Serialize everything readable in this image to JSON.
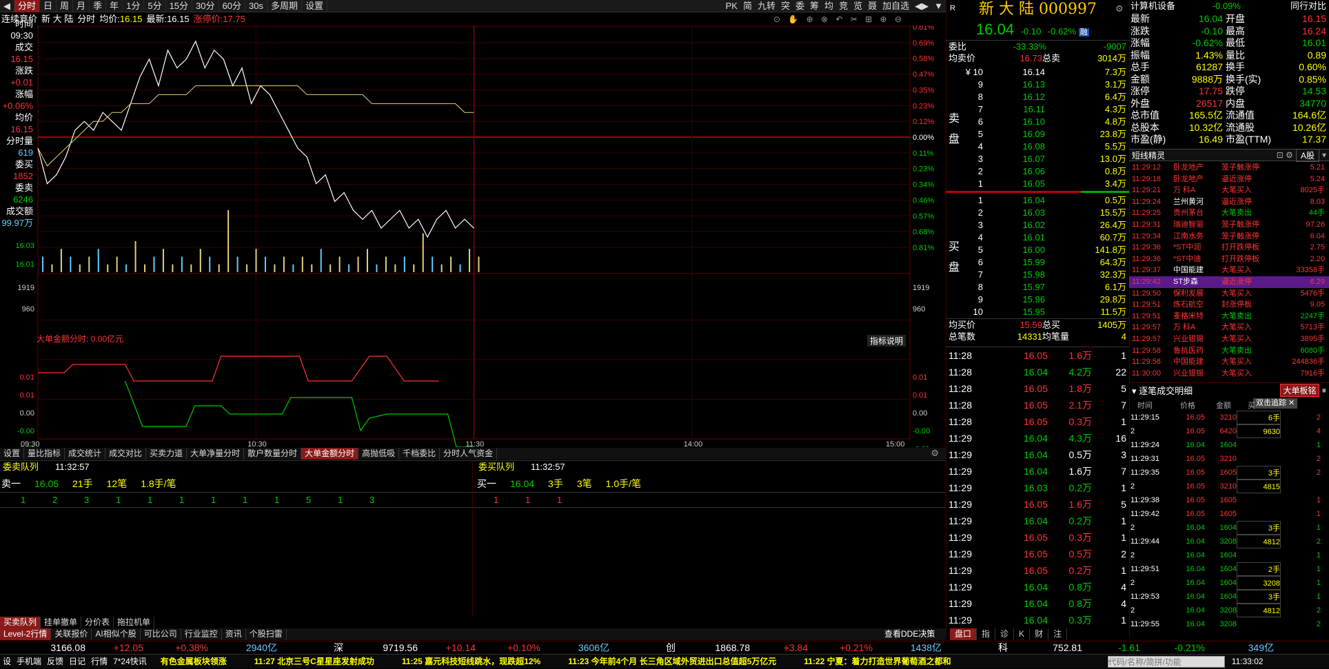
{
  "toolbar": {
    "items": [
      "分时",
      "日",
      "周",
      "月",
      "季",
      "年",
      "1分",
      "5分",
      "15分",
      "30分",
      "60分",
      "30s",
      "多周期",
      "设置"
    ],
    "active": 0,
    "right": [
      "PK",
      "简",
      "九转",
      "突",
      "委",
      "筹",
      "均",
      "竞",
      "览",
      "聂",
      "加自选",
      "◀▶",
      "▼"
    ]
  },
  "info": {
    "mode": "连续竞价",
    "name": "新 大 陆",
    "label_fs": "分时",
    "label_avg": "均价:",
    "avg": "16.15",
    "label_last": "最新:",
    "last": "16.15",
    "label_limit": "涨停价:",
    "limit": "17.75"
  },
  "left": {
    "rows": [
      {
        "l": "时间",
        "v": "09:30",
        "c": "w"
      },
      {
        "l": "成交",
        "v": "16.15",
        "c": "r"
      },
      {
        "l": "涨跌",
        "v": "+0.01",
        "c": "r"
      },
      {
        "l": "涨幅",
        "v": "+0.06%",
        "c": "r"
      },
      {
        "l": "均价",
        "v": "16.15",
        "c": "r"
      },
      {
        "l": "分时量",
        "v": "619",
        "c": "c"
      },
      {
        "l": "委买",
        "v": "1852",
        "c": "r"
      },
      {
        "l": "委卖",
        "v": "6246",
        "c": "g"
      },
      {
        "l": "成交额",
        "v": "99.97万",
        "c": "c"
      }
    ]
  },
  "chart_data": {
    "type": "line",
    "title": "",
    "price_ticks_left": [
      "16.03",
      "16.01"
    ],
    "pct_ticks_right": [
      "0.81%",
      "0.69%",
      "0.58%",
      "0.47%",
      "0.35%",
      "0.23%",
      "0.12%",
      "0.00%",
      "0.11%",
      "0.23%",
      "0.34%",
      "0.46%",
      "0.57%",
      "0.68%",
      "0.81%"
    ],
    "vol_ticks": [
      "1919",
      "960"
    ],
    "x_labels": [
      "09:30",
      "10:30",
      "11:30",
      "14:00",
      "15:00"
    ],
    "price": [
      16.1,
      16.06,
      16.07,
      16.09,
      16.12,
      16.13,
      16.12,
      16.14,
      16.13,
      16.12,
      16.15,
      16.18,
      16.2,
      16.17,
      16.21,
      16.19,
      16.2,
      16.22,
      16.19,
      16.21,
      16.2,
      16.17,
      16.19,
      16.15,
      16.17,
      16.16,
      16.14,
      16.12,
      16.1,
      16.09,
      16.06,
      16.07,
      16.04,
      16.05,
      16.03,
      16.02,
      16.03,
      16.01,
      16.02,
      16.03,
      16.01,
      16.02,
      16.0,
      16.02,
      16.03,
      16.01,
      16.02,
      16.01
    ],
    "avg": [
      16.1,
      16.08,
      16.09,
      16.1,
      16.11,
      16.12,
      16.13,
      16.13,
      16.14,
      16.14,
      16.15,
      16.15,
      16.15,
      16.16,
      16.16,
      16.16,
      16.16,
      16.17,
      16.17,
      16.17,
      16.17,
      16.17,
      16.17,
      16.17,
      16.17,
      16.17,
      16.17,
      16.17,
      16.17,
      16.16,
      16.16,
      16.16,
      16.16,
      16.16,
      16.16,
      16.16,
      16.15,
      16.15,
      16.15,
      16.15,
      16.15,
      16.15,
      16.15,
      16.15,
      16.15,
      16.15,
      16.14,
      16.14
    ],
    "volume": [
      2,
      1,
      3,
      2,
      1,
      2,
      3,
      1,
      2,
      1,
      4,
      1,
      2,
      3,
      1,
      2,
      1,
      3,
      2,
      1,
      8,
      2,
      1,
      3,
      2,
      1,
      2,
      1,
      2,
      1,
      3,
      1,
      2,
      1,
      2,
      3,
      1,
      2,
      1,
      2,
      1,
      5,
      2,
      1,
      2,
      1,
      3,
      2
    ],
    "dde_label": "大单金额分时: 0.00亿元",
    "dde_ticks": [
      "0.01",
      "0.01",
      "0.00",
      "-0.00",
      "-0.01"
    ]
  },
  "tabs": [
    "设置",
    "量比指标",
    "成交统计",
    "成交对比",
    "买卖力道",
    "大单净量分时",
    "散户数量分时",
    "大单金额分时",
    "高抛低吸",
    "千档委比",
    "分时人气资金"
  ],
  "tab_active": 7,
  "indicator_btn": "指标说明",
  "queue": {
    "title": "委卖队列",
    "time": "11:32:57",
    "sell": {
      "label": "卖一",
      "price": "16.05",
      "vol": "21手",
      "cnt": "12笔",
      "avg": "1.8手/笔",
      "items": [
        "1",
        "2",
        "3",
        "1",
        "1",
        "1",
        "1",
        "1",
        "1",
        "5",
        "1",
        "3"
      ]
    },
    "title2": "委买队列",
    "time2": "11:32:57",
    "buy": {
      "label": "买一",
      "price": "16.04",
      "vol": "3手",
      "cnt": "3笔",
      "avg": "1.0手/笔",
      "items": [
        "1",
        "1",
        "1"
      ]
    }
  },
  "bottom_tabs": [
    "买卖队列",
    "挂单撤单",
    "分价表",
    "拖拉机单"
  ],
  "level_tabs": [
    "Level-2行情",
    "关联报价",
    "AI相似个股",
    "可比公司",
    "行业监控",
    "资讯",
    "个股扫雷"
  ],
  "dde_btn": "查看DDE决策",
  "quote": {
    "name": "新 大 陆",
    "code": "000997",
    "price": "16.04",
    "chg": "-0.10",
    "pct": "-0.62%",
    "rong": "融",
    "wb_label": "委比",
    "wb": "-33.33%",
    "wc": "-9007",
    "avg_sell_label": "均卖价",
    "avg_sell": "16.73",
    "total_sell_label": "总卖",
    "total_sell": "3014万",
    "asks": [
      {
        "l": "¥ 10",
        "p": "16.14",
        "v": "7.3万"
      },
      {
        "l": "9",
        "p": "16.13",
        "v": "3.1万"
      },
      {
        "l": "8",
        "p": "16.12",
        "v": "6.4万"
      },
      {
        "l": "7",
        "p": "16.11",
        "v": "4.3万"
      },
      {
        "l": "6",
        "p": "16.10",
        "v": "4.8万"
      },
      {
        "l": "5",
        "p": "16.09",
        "v": "23.8万"
      },
      {
        "l": "4",
        "p": "16.08",
        "v": "5.5万"
      },
      {
        "l": "3",
        "p": "16.07",
        "v": "13.0万"
      },
      {
        "l": "2",
        "p": "16.06",
        "v": "0.8万"
      },
      {
        "l": "1",
        "p": "16.05",
        "v": "3.4万"
      }
    ],
    "bids": [
      {
        "l": "1",
        "p": "16.04",
        "v": "0.5万"
      },
      {
        "l": "2",
        "p": "16.03",
        "v": "15.5万"
      },
      {
        "l": "3",
        "p": "16.02",
        "v": "26.4万"
      },
      {
        "l": "4",
        "p": "16.01",
        "v": "60.7万"
      },
      {
        "l": "5",
        "p": "16.00",
        "v": "141.8万"
      },
      {
        "l": "6",
        "p": "15.99",
        "v": "64.3万"
      },
      {
        "l": "7",
        "p": "15.98",
        "v": "32.3万"
      },
      {
        "l": "8",
        "p": "15.97",
        "v": "6.1万"
      },
      {
        "l": "9",
        "p": "15.96",
        "v": "29.8万"
      },
      {
        "l": "10",
        "p": "15.95",
        "v": "11.5万"
      }
    ],
    "sell_side": "卖盘",
    "buy_side": "买盘",
    "avg_buy_label": "均买价",
    "avg_buy": "15.59",
    "total_buy_label": "总买",
    "total_buy": "1405万",
    "cnt_label": "总笔数",
    "cnt": "14331",
    "avg_vol_label": "均笔量",
    "avg_vol": "4"
  },
  "trades": [
    [
      "11:28",
      "16.05",
      "1.6万",
      "1",
      "r"
    ],
    [
      "11:28",
      "16.04",
      "4.2万",
      "22",
      "g"
    ],
    [
      "11:28",
      "16.05",
      "1.8万",
      "5",
      "r"
    ],
    [
      "11:28",
      "16.05",
      "2.1万",
      "7",
      "r"
    ],
    [
      "11:28",
      "16.05",
      "0.3万",
      "1",
      "r"
    ],
    [
      "11:29",
      "16.04",
      "4.3万",
      "16",
      "g"
    ],
    [
      "11:29",
      "16.04",
      "0.5万",
      "3",
      "w"
    ],
    [
      "11:29",
      "16.04",
      "1.6万",
      "7",
      "w"
    ],
    [
      "11:29",
      "16.03",
      "0.2万",
      "1",
      "g"
    ],
    [
      "11:29",
      "16.05",
      "1.6万",
      "5",
      "r"
    ],
    [
      "11:29",
      "16.04",
      "0.2万",
      "1",
      "g"
    ],
    [
      "11:29",
      "16.05",
      "0.3万",
      "1",
      "r"
    ],
    [
      "11:29",
      "16.05",
      "0.5万",
      "2",
      "r"
    ],
    [
      "11:29",
      "16.05",
      "0.2万",
      "1",
      "r"
    ],
    [
      "11:29",
      "16.04",
      "0.8万",
      "4",
      "g"
    ],
    [
      "11:29",
      "16.04",
      "0.8万",
      "4",
      "g"
    ],
    [
      "11:29",
      "16.04",
      "0.3万",
      "1",
      "g"
    ]
  ],
  "sector": {
    "name": "计算机设备",
    "pct": "-0.09%",
    "peer": "同行对比"
  },
  "stats": [
    [
      "最新",
      "16.04",
      "g",
      "开盘",
      "16.15",
      "r"
    ],
    [
      "涨跌",
      "-0.10",
      "g",
      "最高",
      "16.24",
      "r"
    ],
    [
      "涨幅",
      "-0.62%",
      "g",
      "最低",
      "16.01",
      "g"
    ],
    [
      "振幅",
      "1.43%",
      "y",
      "量比",
      "0.89",
      "y"
    ],
    [
      "总手",
      "61287",
      "y",
      "换手",
      "0.60%",
      "y"
    ],
    [
      "金额",
      "9888万",
      "y",
      "换手(实)",
      "0.85%",
      "y"
    ],
    [
      "涨停",
      "17.75",
      "r",
      "跌停",
      "14.53",
      "g"
    ],
    [
      "外盘",
      "26517",
      "r",
      "内盘",
      "34770",
      "g"
    ],
    [
      "总市值",
      "165.5亿",
      "y",
      "流通值",
      "164.6亿",
      "y"
    ],
    [
      "总股本",
      "10.32亿",
      "y",
      "流通股",
      "10.26亿",
      "y"
    ],
    [
      "市盈(静)",
      "16.49",
      "y",
      "市盈(TTM)",
      "17.37",
      "y"
    ]
  ],
  "sprite": {
    "title": "短线精灵",
    "market": "A股",
    "rows": [
      [
        "11:29:12",
        "卧龙地产",
        "笼子触涨停",
        "5.21",
        "r"
      ],
      [
        "11:29:18",
        "卧龙地产",
        "逼近涨停",
        "5.24",
        "r"
      ],
      [
        "11:29:21",
        "万 科A",
        "大笔买入",
        "8025手",
        "r"
      ],
      [
        "11:29:24",
        "兰州黄河",
        "逼近涨停",
        "8.03",
        "r"
      ],
      [
        "11:29:25",
        "贵州茅台",
        "大笔卖出",
        "44手",
        "g"
      ],
      [
        "11:29:31",
        "瑞迪智驱",
        "笼子触涨停",
        "97.26",
        "r"
      ],
      [
        "11:29:34",
        "江南水务",
        "笼子触涨停",
        "6.04",
        "r"
      ],
      [
        "11:29:36",
        "*ST中润",
        "打开跌停板",
        "2.75",
        "r"
      ],
      [
        "11:29:36",
        "*ST中迪",
        "打开跌停板",
        "2.20",
        "r"
      ],
      [
        "11:29:37",
        "中国能建",
        "大笔买入",
        "33358手",
        "r"
      ],
      [
        "11:29:42",
        "ST步森",
        "逼近涨停",
        "6.29",
        "r"
      ],
      [
        "11:29:50",
        "保利发展",
        "大笔买入",
        "5476手",
        "r"
      ],
      [
        "11:29:51",
        "炼石航空",
        "封涨停板",
        "9.05",
        "r"
      ],
      [
        "11:29:51",
        "麦格米特",
        "大笔卖出",
        "2247手",
        "g"
      ],
      [
        "11:29:57",
        "万 科A",
        "大笔买入",
        "5713手",
        "r"
      ],
      [
        "11:29:57",
        "兴业银锡",
        "大笔买入",
        "3895手",
        "r"
      ],
      [
        "11:29:58",
        "鲁抗医药",
        "大笔卖出",
        "6080手",
        "g"
      ],
      [
        "11:29:58",
        "中国能建",
        "大笔买入",
        "244836手",
        "r"
      ],
      [
        "11:30:00",
        "兴业银锡",
        "大笔买入",
        "7916手",
        "r"
      ]
    ]
  },
  "detail": {
    "title": "逐笔成交明细",
    "big_btn": "大单板铭",
    "hint": "双击追踪",
    "cols": [
      "时间",
      "价格",
      "金额",
      "买"
    ],
    "rows": [
      [
        "11:29:15",
        "16.05",
        "3210",
        "6手",
        "2",
        "r"
      ],
      [
        "2",
        "16.05",
        "6420",
        "9630",
        "4",
        "r"
      ],
      [
        "11:29:24",
        "16.04",
        "1604",
        "",
        "1",
        "g"
      ],
      [
        "11:29:31",
        "16.05",
        "3210",
        "",
        "2",
        "r"
      ],
      [
        "11:29:35",
        "16.05",
        "1605",
        "3手",
        "2",
        "r"
      ],
      [
        "2",
        "16.05",
        "3210",
        "4815",
        "",
        "r"
      ],
      [
        "11:29:38",
        "16.05",
        "1605",
        "",
        "1",
        "r"
      ],
      [
        "11:29:42",
        "16.05",
        "1605",
        "",
        "1",
        "r"
      ],
      [
        "2",
        "16.04",
        "1604",
        "3手",
        "1",
        "g"
      ],
      [
        "11:29:44",
        "16.04",
        "3208",
        "4812",
        "2",
        "g"
      ],
      [
        "2",
        "16.04",
        "1604",
        "",
        "1",
        "g"
      ],
      [
        "11:29:51",
        "16.04",
        "1604",
        "2手",
        "1",
        "g"
      ],
      [
        "2",
        "16.04",
        "1604",
        "3208",
        "1",
        "g"
      ],
      [
        "11:29:53",
        "16.04",
        "1604",
        "3手",
        "1",
        "g"
      ],
      [
        "2",
        "16.04",
        "3208",
        "4812",
        "2",
        "g"
      ],
      [
        "11:29:55",
        "16.04",
        "3208",
        "",
        "2",
        "g"
      ]
    ]
  },
  "panel_tabs": [
    "盘口",
    "指",
    "诊",
    "K",
    "财",
    "注"
  ],
  "indices": [
    [
      "",
      "3166.08",
      "+12.05",
      "+0.38%",
      "2940亿"
    ],
    [
      "深",
      "9719.56",
      "+10.14",
      "+0.10%",
      "3606亿"
    ],
    [
      "创",
      "1868.78",
      "+3.84",
      "+0.21%",
      "1438亿"
    ],
    [
      "科",
      "752.81",
      "-1.61",
      "-0.21%",
      "349亿"
    ]
  ],
  "status": {
    "items": [
      "设",
      "手机端",
      "反馈",
      "日记",
      "行情",
      "7*24快讯"
    ],
    "news": [
      "有色金属板块领涨",
      "11:27 北京三号C星星座发射成功",
      "11:25 嘉元科技短线跳水，现跌超12%",
      "11:23 今年前4个月 长三角区域外贸进出口总值超5万亿元",
      "11:22 宁夏：着力打造世界葡萄酒之都和"
    ],
    "search_placeholder": "代码/名称/简拼/功能",
    "clock": "11:33:02"
  }
}
